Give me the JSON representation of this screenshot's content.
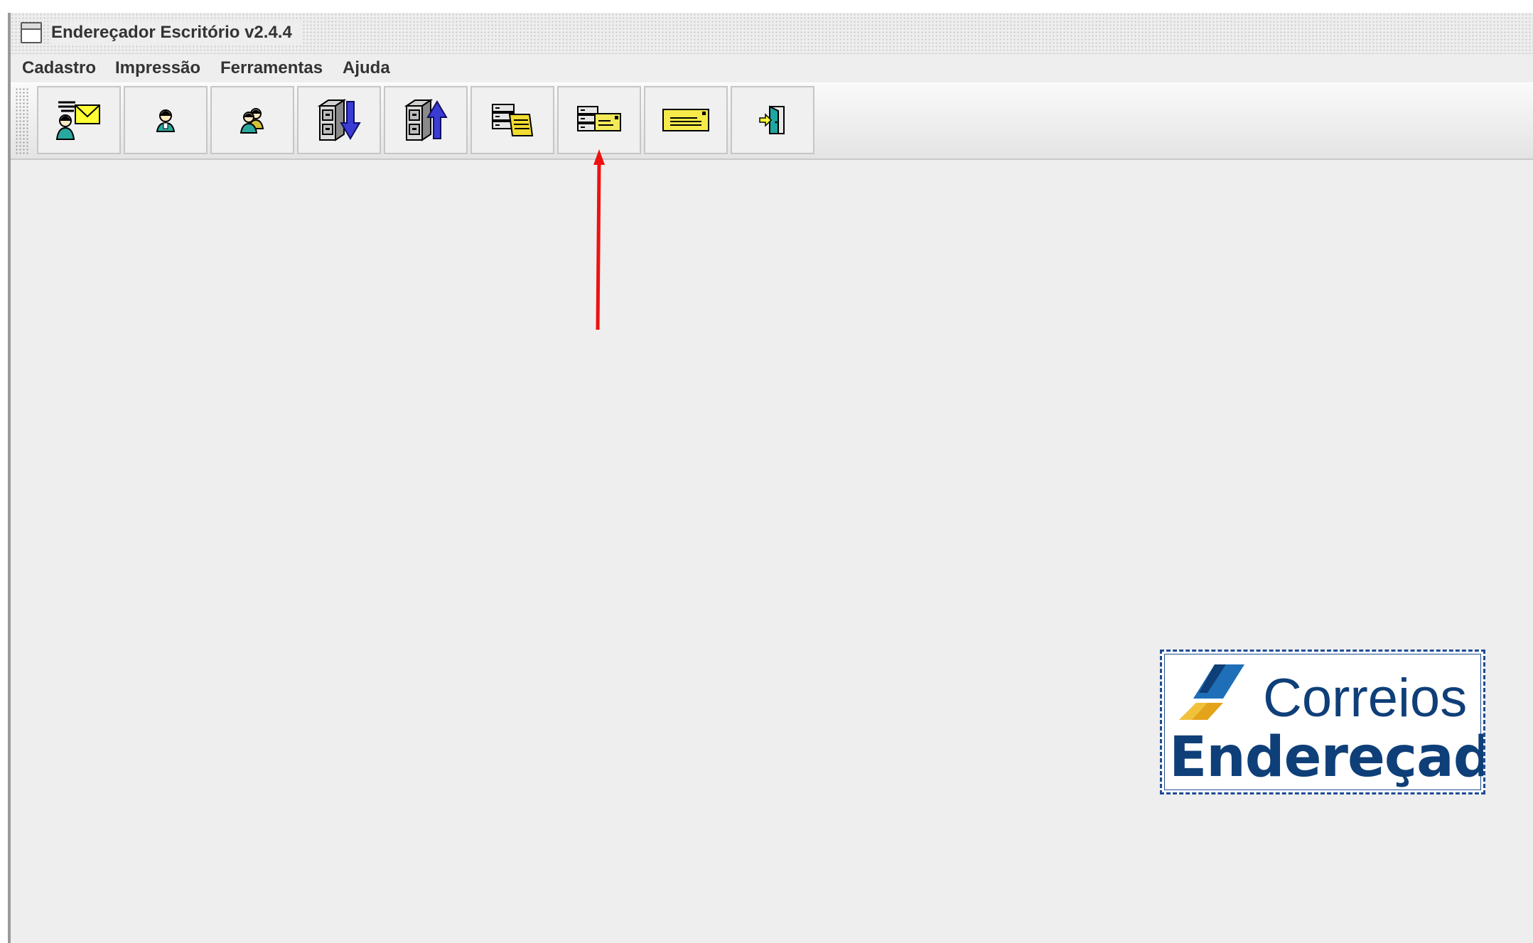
{
  "window": {
    "title": "Endereçador Escritório v2.4.4"
  },
  "menu": {
    "items": [
      "Cadastro",
      "Impressão",
      "Ferramentas",
      "Ajuda"
    ]
  },
  "toolbar": {
    "buttons": [
      {
        "icon": "recipient-envelope-icon"
      },
      {
        "icon": "person-icon"
      },
      {
        "icon": "people-icon"
      },
      {
        "icon": "cabinet-import-icon"
      },
      {
        "icon": "cabinet-export-icon"
      },
      {
        "icon": "database-stack-icon"
      },
      {
        "icon": "database-envelope-icon"
      },
      {
        "icon": "envelope-label-icon"
      },
      {
        "icon": "exit-door-icon"
      }
    ]
  },
  "annotation": {
    "color": "#ee1111",
    "points_to": "database-envelope-icon"
  },
  "logo": {
    "brand": "Correios",
    "product": "Endereçador",
    "colors": {
      "blue": "#0f3f78",
      "accent_blue": "#1f6fb8",
      "yellow": "#f2b01e"
    }
  }
}
